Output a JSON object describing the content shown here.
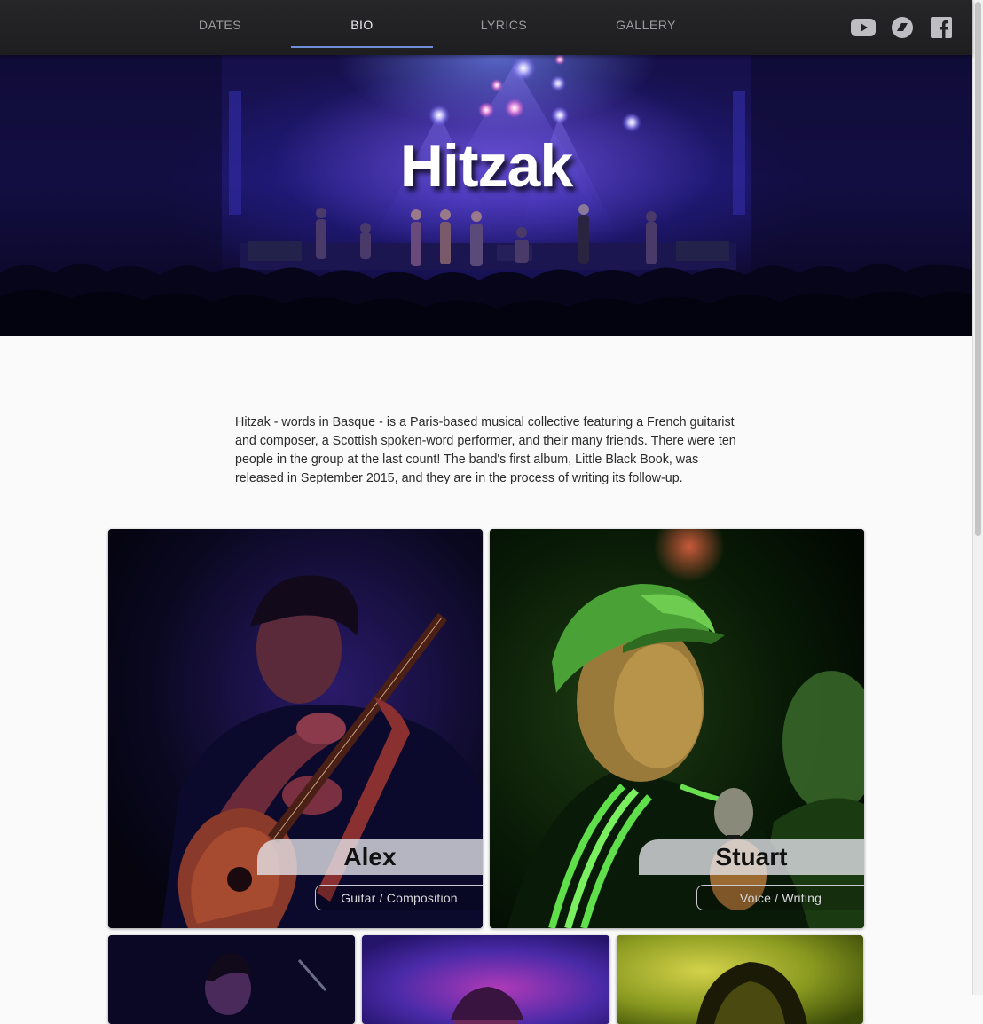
{
  "nav": {
    "tabs": [
      {
        "label": "DATES",
        "active": false
      },
      {
        "label": "BIO",
        "active": true
      },
      {
        "label": "LYRICS",
        "active": false
      },
      {
        "label": "GALLERY",
        "active": false
      }
    ],
    "social_icons": [
      "youtube-icon",
      "bandcamp-icon",
      "facebook-icon"
    ],
    "accent_color": "#6f8fd6"
  },
  "hero": {
    "title": "Hitzak"
  },
  "bio": {
    "text": "Hitzak - words in Basque - is a Paris-based musical collective featuring a French guitarist and composer, a Scottish spoken-word performer, and their many friends. There were ten people in the group at the last count! The band's first album, Little Black Book, was released in September 2015, and they are in the process of writing its follow-up."
  },
  "members": [
    {
      "name": "Alex",
      "role": "Guitar / Composition"
    },
    {
      "name": "Stuart",
      "role": "Voice / Writing"
    }
  ]
}
